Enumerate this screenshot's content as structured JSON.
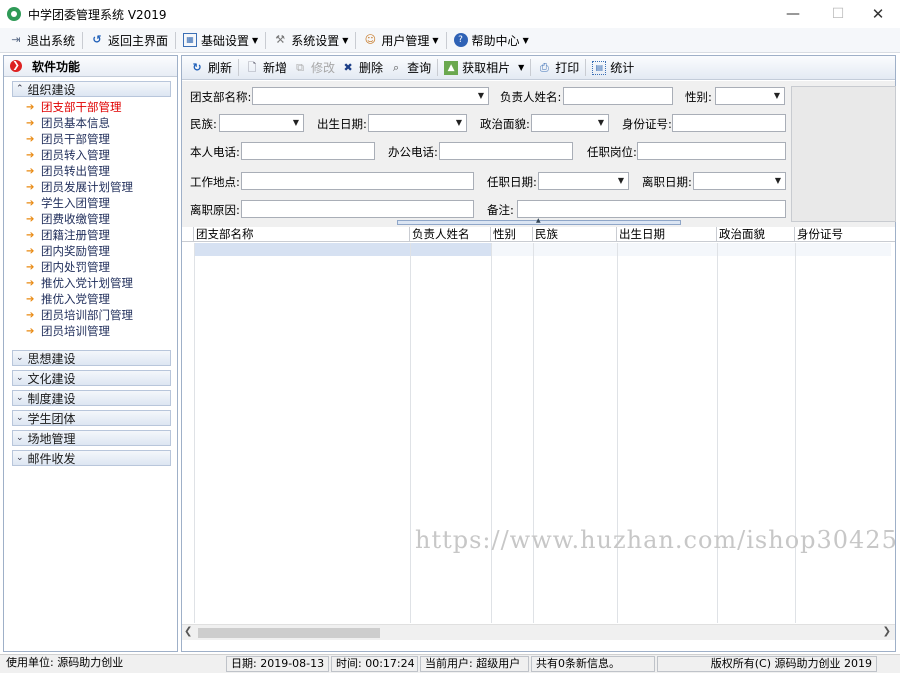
{
  "window": {
    "title": "中学团委管理系统 V2019"
  },
  "menubar": {
    "items": [
      {
        "label": "退出系统",
        "icon": "exit-icon",
        "dropdown": false
      },
      {
        "label": "返回主界面",
        "icon": "back-icon",
        "dropdown": false
      },
      {
        "label": "基础设置",
        "icon": "grid-icon",
        "dropdown": true
      },
      {
        "label": "系统设置",
        "icon": "tools-icon",
        "dropdown": true
      },
      {
        "label": "用户管理",
        "icon": "users-icon",
        "dropdown": true
      },
      {
        "label": "帮助中心",
        "icon": "help-icon",
        "dropdown": true
      }
    ]
  },
  "sidebar": {
    "header": "软件功能",
    "groups": [
      {
        "label": "组织建设",
        "expanded": true,
        "items": [
          {
            "label": "团支部干部管理",
            "active": true
          },
          {
            "label": "团员基本信息"
          },
          {
            "label": "团员干部管理"
          },
          {
            "label": "团员转入管理"
          },
          {
            "label": "团员转出管理"
          },
          {
            "label": "团员发展计划管理"
          },
          {
            "label": "学生入团管理"
          },
          {
            "label": "团费收缴管理"
          },
          {
            "label": "团籍注册管理"
          },
          {
            "label": "团内奖励管理"
          },
          {
            "label": "团内处罚管理"
          },
          {
            "label": "推优入党计划管理"
          },
          {
            "label": "推优入党管理"
          },
          {
            "label": "团员培训部门管理"
          },
          {
            "label": "团员培训管理"
          }
        ]
      },
      {
        "label": "思想建设",
        "expanded": false
      },
      {
        "label": "文化建设",
        "expanded": false
      },
      {
        "label": "制度建设",
        "expanded": false
      },
      {
        "label": "学生团体",
        "expanded": false
      },
      {
        "label": "场地管理",
        "expanded": false
      },
      {
        "label": "邮件收发",
        "expanded": false
      }
    ]
  },
  "toolbar": {
    "refresh": "刷新",
    "add": "新增",
    "edit": "修改",
    "delete": "删除",
    "query": "查询",
    "get_photo": "获取相片",
    "print": "打印",
    "stats": "统计"
  },
  "form": {
    "branch_name": "团支部名称:",
    "leader_name": "负责人姓名:",
    "gender": "性别:",
    "ethnicity": "民族:",
    "birth_date": "出生日期:",
    "political_status": "政治面貌:",
    "id_number": "身份证号:",
    "personal_phone": "本人电话:",
    "office_phone": "办公电话:",
    "position": "任职岗位:",
    "work_place": "工作地点:",
    "start_date": "任职日期:",
    "leave_date": "离职日期:",
    "leave_reason": "离职原因:",
    "remarks": "备注:"
  },
  "grid": {
    "columns": [
      "团支部名称",
      "负责人姓名",
      "性别",
      "民族",
      "出生日期",
      "政治面貌",
      "身份证号"
    ]
  },
  "watermark": "https://www.huzhan.com/ishop30425",
  "statusbar": {
    "unit": "使用单位: 源码助力创业",
    "date": "日期: 2019-08-13",
    "time": "时间: 00:17:24",
    "user": "当前用户: 超级用户",
    "messages": "共有0条新信息。",
    "copyright": "版权所有(C) 源码助力创业 2019"
  }
}
